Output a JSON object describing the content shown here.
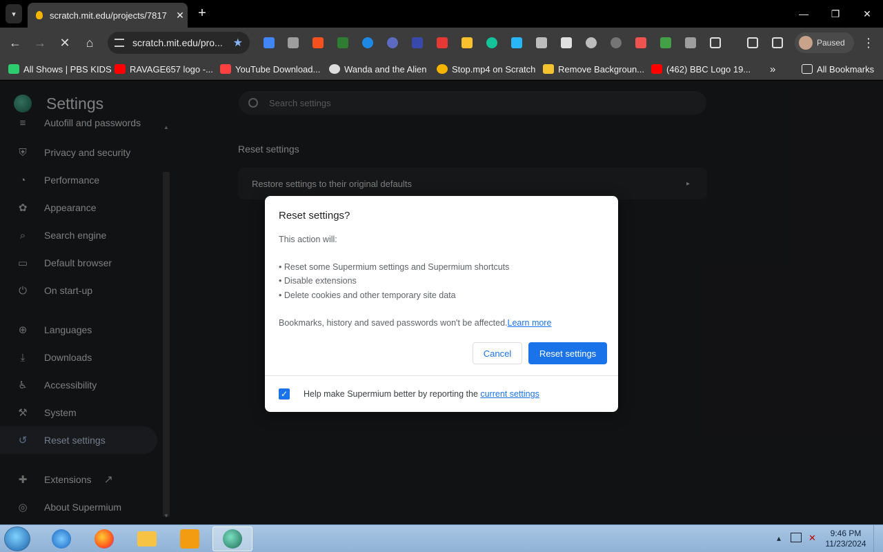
{
  "tabstrip": {
    "tab_title": "scratch.mit.edu/projects/7817",
    "tab_close": "✕",
    "new_tab": "+",
    "window_controls": {
      "minimize": "—",
      "restore": "❐",
      "close": "✕"
    }
  },
  "toolbar": {
    "back": "←",
    "forward": "→",
    "stop": "✕",
    "home": "⌂",
    "url": "scratch.mit.edu/pro...",
    "bookmark_star": "★",
    "profile_label": "Paused",
    "menu": "⋮",
    "extensions": [
      {
        "name": "docs-ext-icon",
        "color": "#4285f4"
      },
      {
        "name": "screen-ext-icon",
        "color": "#9e9e9e"
      },
      {
        "name": "shield-ext-icon",
        "color": "#f4511e"
      },
      {
        "name": "link-ext-icon",
        "color": "#2e7d32"
      },
      {
        "name": "infinity-ext-icon",
        "color": "#1e88e5"
      },
      {
        "name": "circle-ext-icon",
        "color": "#5c6bc0"
      },
      {
        "name": "refresh-ext-icon",
        "color": "#3949ab"
      },
      {
        "name": "adobe-ext-icon",
        "color": "#e53935"
      },
      {
        "name": "diamond-ext-icon",
        "color": "#fbc02d"
      },
      {
        "name": "grammar-ext-icon",
        "color": "#15c39a"
      },
      {
        "name": "pen-ext-icon",
        "color": "#29b6f6"
      },
      {
        "name": "rocket-ext-icon",
        "color": "#bdbdbd"
      },
      {
        "name": "trash-ext-icon",
        "color": "#e0e0e0"
      },
      {
        "name": "sphere-ext-icon",
        "color": "#bdbdbd"
      },
      {
        "name": "gauge-ext-icon",
        "color": "#757575"
      },
      {
        "name": "pdf-ext-icon",
        "color": "#ef5350"
      },
      {
        "name": "font-ext-icon",
        "color": "#43a047"
      },
      {
        "name": "picture-ext-icon",
        "color": "#9e9e9e"
      },
      {
        "name": "puzzle-icon",
        "color": "#e0e0e0"
      },
      {
        "name": "labs-flask-icon",
        "color": "#e0e0e0"
      },
      {
        "name": "side-panel-icon",
        "color": "#e0e0e0"
      }
    ]
  },
  "bookmarks": {
    "items": [
      {
        "label": "All Shows | PBS KIDS",
        "color": "#2ecc71"
      },
      {
        "label": "RAVAGE657 logo -...",
        "color": "#ff0000"
      },
      {
        "label": "YouTube Download...",
        "color": "#ff4040"
      },
      {
        "label": "Wanda and the Alien",
        "color": "#dddddd"
      },
      {
        "label": "Stop.mp4 on Scratch",
        "color": "#f4b400"
      },
      {
        "label": "Remove Backgroun...",
        "color": "#f4c430"
      },
      {
        "label": "(462) BBC Logo 19...",
        "color": "#ff0000"
      }
    ],
    "overflow": "»",
    "all_bookmarks": "All Bookmarks"
  },
  "settings": {
    "title": "Settings",
    "search_placeholder": "Search settings",
    "nav": [
      {
        "label": "Autofill and passwords",
        "icon": "≡"
      },
      {
        "label": "Privacy and security",
        "icon": "⛨"
      },
      {
        "label": "Performance",
        "icon": "◔"
      },
      {
        "label": "Appearance",
        "icon": "✿"
      },
      {
        "label": "Search engine",
        "icon": "⌕"
      },
      {
        "label": "Default browser",
        "icon": "▭"
      },
      {
        "label": "On start-up",
        "icon": "⏻"
      },
      {
        "label": "Languages",
        "icon": "⊕"
      },
      {
        "label": "Downloads",
        "icon": "⤓"
      },
      {
        "label": "Accessibility",
        "icon": "♿"
      },
      {
        "label": "System",
        "icon": "⚒"
      },
      {
        "label": "Reset settings",
        "icon": "↺"
      },
      {
        "label": "Extensions",
        "icon": "✚"
      },
      {
        "label": "About Supermium",
        "icon": "◎"
      }
    ],
    "extensions_external_icon": "↗",
    "section_heading": "Reset settings",
    "restore_row": "Restore settings to their original defaults",
    "restore_arrow": "▸"
  },
  "dialog": {
    "title": "Reset settings?",
    "intro": "This action will:",
    "bullets": [
      "• Reset some Supermium settings and Supermium shortcuts",
      "• Disable extensions",
      "• Delete cookies and other temporary site data"
    ],
    "note": "Bookmarks, history and saved passwords won't be affected.",
    "learn_more": "Learn more",
    "cancel_label": "Cancel",
    "reset_label": "Reset settings",
    "checkbox_checked": true,
    "checkbox_mark": "✓",
    "checkbox_text": "Help make Supermium better by reporting the ",
    "checkbox_link": "current settings"
  },
  "taskbar": {
    "time": "9:46 PM",
    "date": "11/23/2024",
    "tray_arrow": "▴",
    "apps": [
      {
        "name": "internet-explorer-icon",
        "color": "#1e88e5"
      },
      {
        "name": "firefox-icon",
        "color": "#ff7139"
      },
      {
        "name": "file-explorer-icon",
        "color": "#f6c344"
      },
      {
        "name": "media-player-icon",
        "color": "#f39c12"
      },
      {
        "name": "supermium-icon",
        "color": "#2a9d80"
      }
    ]
  }
}
